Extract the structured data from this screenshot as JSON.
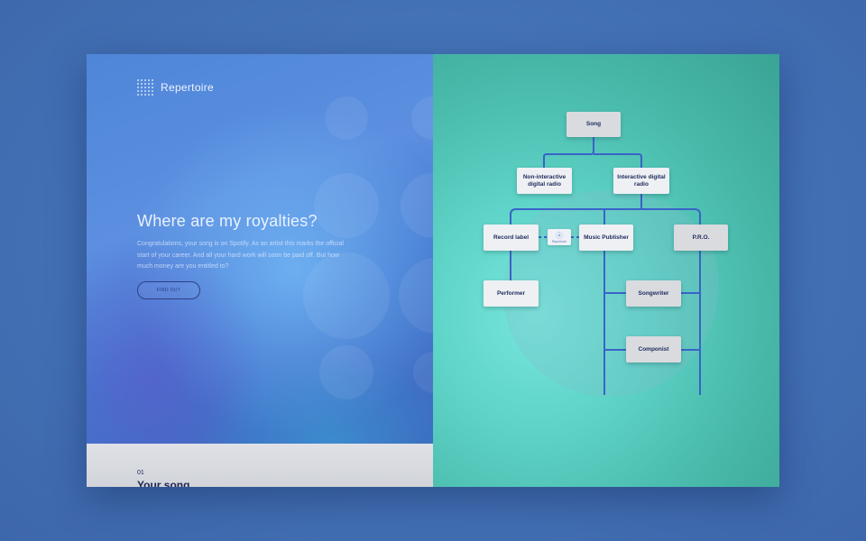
{
  "brand": {
    "name": "Repertoire"
  },
  "hero": {
    "title": "Where are my royalties?",
    "body": "Congratulations, your song is on Spotify. As an artist this marks the official start of your career. And all your hard work will soon be paid off. But how much money are you entitled to?",
    "button_label": "FIND OUT"
  },
  "section": {
    "number": "01",
    "title": "Your song"
  },
  "diagram": {
    "nodes": {
      "song": "Song",
      "non_interactive": "Non-interactive digital radio",
      "interactive": "Interactive digital radio",
      "record_label": "Record label",
      "music_publisher": "Music Publisher",
      "pro": "P.R.O.",
      "performer": "Performer",
      "songwriter": "Songwriter",
      "componist": "Componist"
    },
    "badge_label": "Repertoire"
  },
  "colors": {
    "line": "#3a63c9",
    "node_text": "#1e2a5c",
    "accent": "#2e3f86"
  }
}
